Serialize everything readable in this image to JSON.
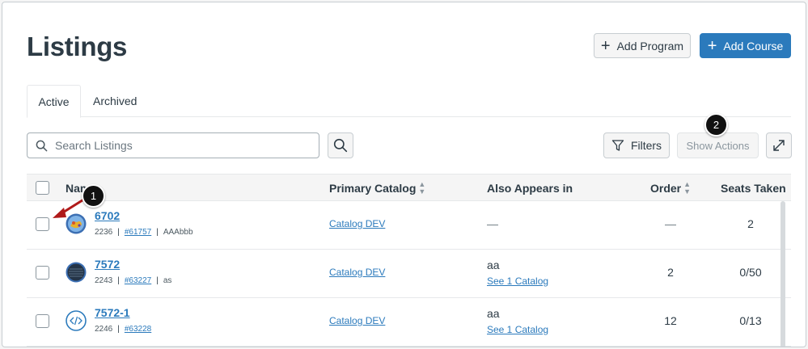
{
  "page": {
    "title": "Listings"
  },
  "header": {
    "add_program": "Add Program",
    "add_course": "Add Course"
  },
  "tabs": [
    {
      "label": "Active"
    },
    {
      "label": "Archived"
    }
  ],
  "search": {
    "placeholder": "Search Listings"
  },
  "toolbar": {
    "filters": "Filters",
    "show_actions": "Show Actions"
  },
  "callouts": {
    "one": "1",
    "two": "2"
  },
  "table": {
    "columns": {
      "name": "Name",
      "primary_catalog": "Primary Catalog",
      "also_appears": "Also Appears in",
      "order": "Order",
      "seats": "Seats Taken"
    },
    "rows": [
      {
        "name": "6702",
        "id": "2236",
        "ref": "#61757",
        "tag": "AAAbbb",
        "catalog": "Catalog DEV",
        "also": "—",
        "also_link": "",
        "order": "—",
        "seats": "2"
      },
      {
        "name": "7572",
        "id": "2243",
        "ref": "#63227",
        "tag": "as",
        "catalog": "Catalog DEV",
        "also": "aa",
        "also_link": "See 1 Catalog",
        "order": "2",
        "seats": "0/50"
      },
      {
        "name": "7572-1",
        "id": "2246",
        "ref": "#63228",
        "tag": "",
        "catalog": "Catalog DEV",
        "also": "aa",
        "also_link": "See 1 Catalog",
        "order": "12",
        "seats": "0/13"
      }
    ]
  },
  "colors": {
    "accent": "#2b7abc",
    "text": "#2d3b45",
    "arrow": "#b01a1a"
  }
}
